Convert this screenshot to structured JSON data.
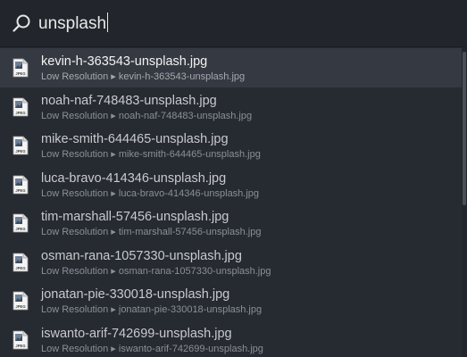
{
  "search": {
    "query": "unsplash"
  },
  "results": [
    {
      "title": "kevin-h-363543-unsplash.jpg",
      "resolution": "Low Resolution",
      "separator": "▸",
      "filename": "kevin-h-363543-unsplash.jpg",
      "icon": "jpeg-file-icon",
      "selected": true
    },
    {
      "title": "noah-naf-748483-unsplash.jpg",
      "resolution": "Low Resolution",
      "separator": "▸",
      "filename": "noah-naf-748483-unsplash.jpg",
      "icon": "jpeg-file-icon",
      "selected": false
    },
    {
      "title": "mike-smith-644465-unsplash.jpg",
      "resolution": "Low Resolution",
      "separator": "▸",
      "filename": "mike-smith-644465-unsplash.jpg",
      "icon": "jpeg-file-icon",
      "selected": false
    },
    {
      "title": "luca-bravo-414346-unsplash.jpg",
      "resolution": "Low Resolution",
      "separator": "▸",
      "filename": "luca-bravo-414346-unsplash.jpg",
      "icon": "jpeg-file-icon",
      "selected": false
    },
    {
      "title": "tim-marshall-57456-unsplash.jpg",
      "resolution": "Low Resolution",
      "separator": "▸",
      "filename": "tim-marshall-57456-unsplash.jpg",
      "icon": "jpeg-file-icon",
      "selected": false
    },
    {
      "title": "osman-rana-1057330-unsplash.jpg",
      "resolution": "Low Resolution",
      "separator": "▸",
      "filename": "osman-rana-1057330-unsplash.jpg",
      "icon": "jpeg-file-icon",
      "selected": false
    },
    {
      "title": "jonatan-pie-330018-unsplash.jpg",
      "resolution": "Low Resolution",
      "separator": "▸",
      "filename": "jonatan-pie-330018-unsplash.jpg",
      "icon": "jpeg-file-icon",
      "selected": false
    },
    {
      "title": "iswanto-arif-742699-unsplash.jpg",
      "resolution": "Low Resolution",
      "separator": "▸",
      "filename": "iswanto-arif-742699-unsplash.jpg",
      "icon": "jpeg-file-icon",
      "selected": false
    }
  ],
  "icon_text": "JPEG",
  "colors": {
    "background": "#262a31",
    "selected_row": "#353a42",
    "title_text": "#c8cacd",
    "subtitle_text": "#8b8f96"
  }
}
